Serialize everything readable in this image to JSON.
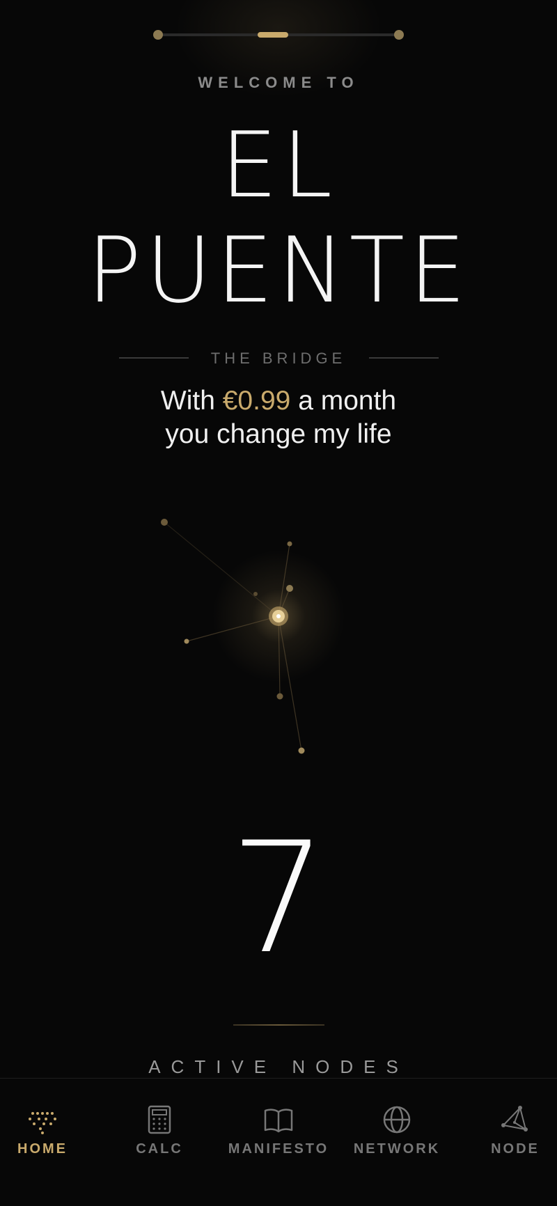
{
  "onboarding": {
    "welcome": "WELCOME TO",
    "title_line1": "EL",
    "title_line2": "PUENTE",
    "subtitle": "THE BRIDGE",
    "tagline_prefix": "With",
    "price": "€0.99",
    "tagline_suffix": "a month",
    "tagline_line2": "you change my life"
  },
  "counter": {
    "value": "7",
    "label": "ACTIVE NODES"
  },
  "nav": {
    "items": [
      {
        "label": "HOME",
        "icon": "home-dots-icon",
        "active": true
      },
      {
        "label": "CALC",
        "icon": "calculator-icon",
        "active": false
      },
      {
        "label": "MANIFESTO",
        "icon": "book-icon",
        "active": false
      },
      {
        "label": "NETWORK",
        "icon": "globe-icon",
        "active": false
      },
      {
        "label": "NODE",
        "icon": "node-graph-icon",
        "active": false
      }
    ]
  },
  "colors": {
    "accent": "#c9aa6c",
    "background": "#070707",
    "muted": "#777777"
  }
}
